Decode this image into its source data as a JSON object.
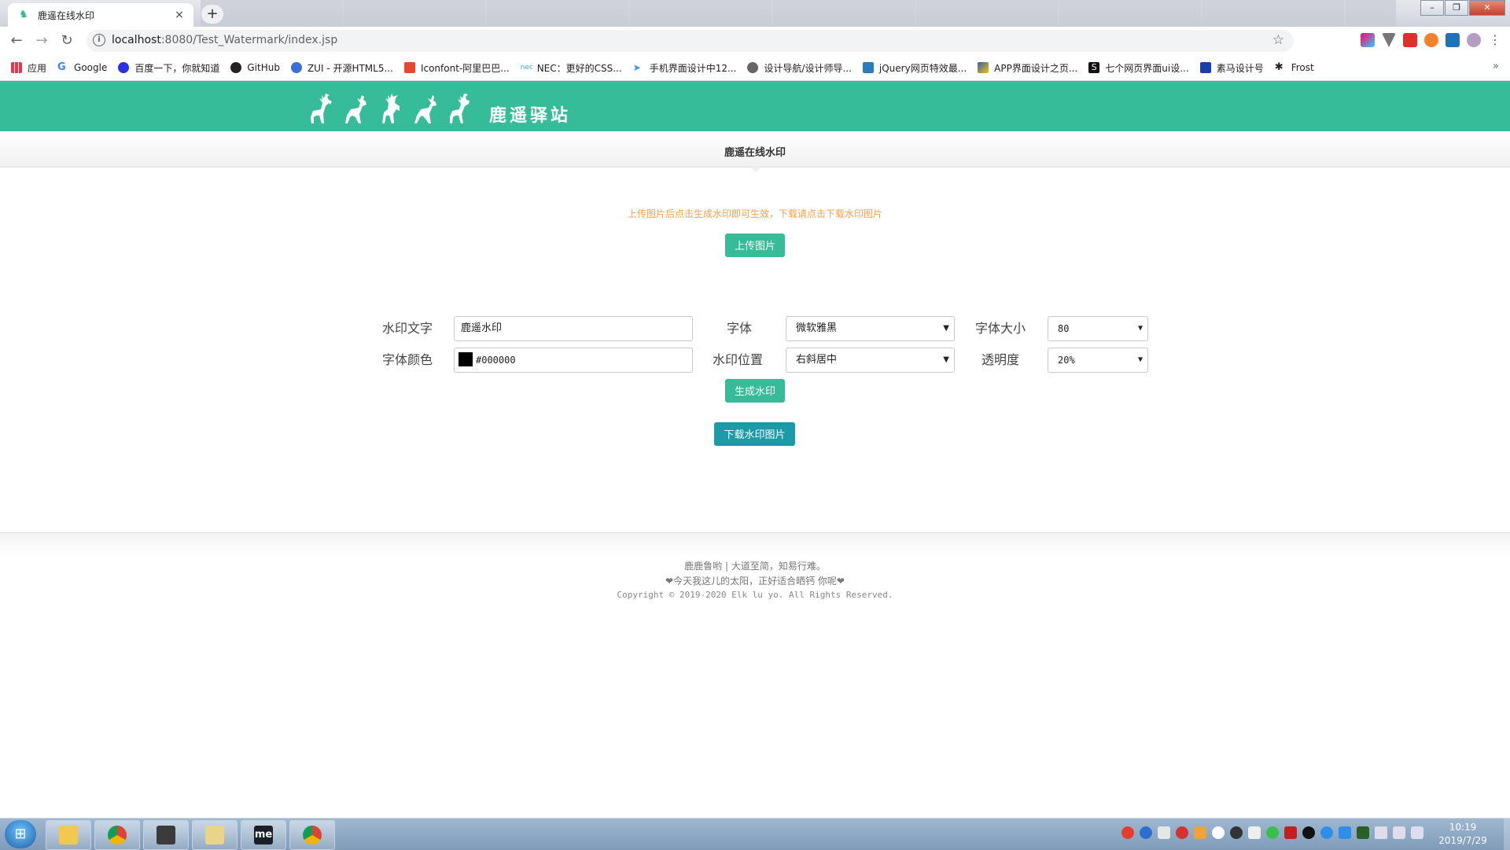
{
  "browser": {
    "tab_title": "鹿遥在线水印",
    "tab_close": "×",
    "new_tab": "+",
    "url_host": "localhost",
    "url_path": ":8080/Test_Watermark/index.jsp",
    "bookmarks": [
      "应用",
      "Google",
      "百度一下，你就知道",
      "GitHub",
      "ZUI - 开源HTML5...",
      "Iconfont-阿里巴巴...",
      "NEC：更好的CSS...",
      "手机界面设计中12...",
      "设计导航/设计师导...",
      "jQuery网页特效最...",
      "APP界面设计之页...",
      "七个网页界面ui设...",
      "素马设计号",
      "Frost"
    ],
    "bookmarks_more": "»"
  },
  "site": {
    "brand": "鹿遥驿站",
    "nav_title": "鹿遥在线水印",
    "hint": "上传图片后点击生成水印即可生效，下载请点击下载水印图片",
    "upload_button": "上传图片"
  },
  "form": {
    "watermark_text_label": "水印文字",
    "watermark_text_value": "鹿遥水印",
    "font_label": "字体",
    "font_value": "微软雅黑",
    "font_size_label": "字体大小",
    "font_size_value": "80",
    "font_color_label": "字体颜色",
    "font_color_value": "#000000",
    "position_label": "水印位置",
    "position_value": "右斜居中",
    "opacity_label": "透明度",
    "opacity_value": "20%",
    "generate_button": "生成水印",
    "download_button": "下载水印图片"
  },
  "footer": {
    "line1": "鹿鹿鲁哟 | 大道至简，知易行难。",
    "line2": "❤今天我这儿的太阳，正好适合晒钙 你呢❤",
    "line3": "Copyright © 2019-2020 Elk lu yo. All Rights Reserved."
  },
  "taskbar": {
    "time": "10:19",
    "date": "2019/7/29",
    "apps": [
      "explorer-icon",
      "chrome-icon",
      "sublime-icon",
      "folder-icon",
      "me-icon",
      "chrome-icon"
    ],
    "me_label": "me"
  },
  "colors": {
    "brand_green": "#36bc99",
    "button_green": "#37bc98",
    "button_teal": "#1b9aaa",
    "hint_orange": "#f5a04a"
  }
}
